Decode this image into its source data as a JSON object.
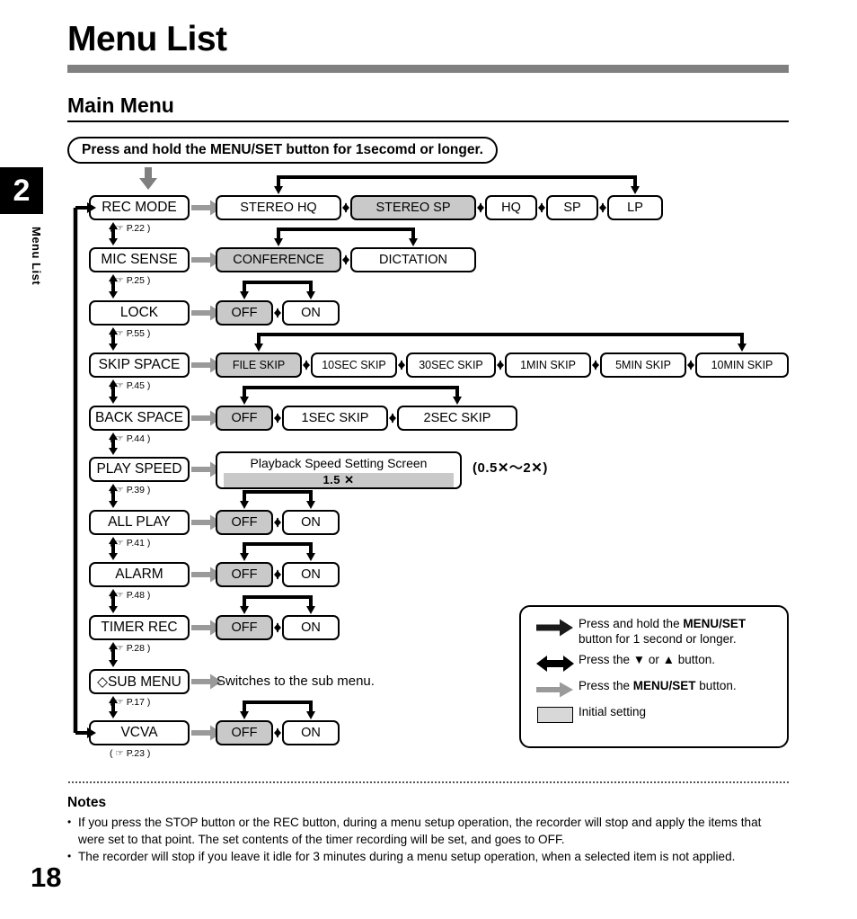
{
  "page": {
    "title": "Menu List",
    "section": "Main Menu",
    "number": "18",
    "tab_number": "2",
    "tab_label": "Menu List"
  },
  "entry_banner": {
    "text": "Press and hold the MENU/SET button for 1secomd or longer."
  },
  "menu_rows": [
    {
      "name": "REC MODE",
      "page_ref": "( ☞ P.22 )",
      "options": [
        "STEREO HQ",
        "STEREO SP",
        "HQ",
        "SP",
        "LP"
      ],
      "initial": "STEREO SP"
    },
    {
      "name": "MIC SENSE",
      "page_ref": "( ☞ P.25 )",
      "options": [
        "CONFERENCE",
        "DICTATION"
      ],
      "initial": "CONFERENCE"
    },
    {
      "name": "LOCK",
      "page_ref": "( ☞ P.55 )",
      "options": [
        "OFF",
        "ON"
      ],
      "initial": "OFF"
    },
    {
      "name": "SKIP SPACE",
      "page_ref": "( ☞ P.45 )",
      "options": [
        "FILE SKIP",
        "10SEC SKIP",
        "30SEC SKIP",
        "1MIN SKIP",
        "5MIN SKIP",
        "10MIN SKIP"
      ],
      "initial": "FILE SKIP"
    },
    {
      "name": "BACK SPACE",
      "page_ref": "( ☞ P.44 )",
      "options": [
        "OFF",
        "1SEC SKIP",
        "2SEC SKIP"
      ],
      "initial": "OFF"
    },
    {
      "name": "PLAY SPEED",
      "page_ref": "( ☞ P.39 )",
      "options": [],
      "initial": ""
    },
    {
      "name": "ALL PLAY",
      "page_ref": "( ☞ P.41 )",
      "options": [
        "OFF",
        "ON"
      ],
      "initial": "OFF"
    },
    {
      "name": "ALARM",
      "page_ref": "( ☞ P.48 )",
      "options": [
        "OFF",
        "ON"
      ],
      "initial": "OFF"
    },
    {
      "name": "TIMER REC",
      "page_ref": "( ☞ P.28 )",
      "options": [
        "OFF",
        "ON"
      ],
      "initial": "OFF"
    },
    {
      "name": "◇SUB MENU",
      "page_ref": "( ☞ P.17 )",
      "options": [],
      "initial": ""
    },
    {
      "name": "VCVA",
      "page_ref": "( ☞ P.23 )",
      "options": [
        "OFF",
        "ON"
      ],
      "initial": "OFF"
    }
  ],
  "play_speed": {
    "screen_title": "Playback Speed Setting Screen",
    "screen_value": "1.5 ✕",
    "range": "(0.5✕～2✕)"
  },
  "sub_menu": {
    "note": "Switches to the sub menu."
  },
  "legend": {
    "items": [
      {
        "icon": "black-thick-right-arrow-icon",
        "text_parts": [
          "Press and hold the ",
          "MENU/SET",
          ""
        ],
        "line2": "button for 1 second or longer."
      },
      {
        "icon": "black-double-head-arrow-icon",
        "text_parts": [
          "Press the ▼ or ▲ button."
        ],
        "line2": ""
      },
      {
        "icon": "gray-right-arrow-icon",
        "text_parts": [
          "Press the ",
          "MENU/SET",
          " button."
        ],
        "line2": ""
      },
      {
        "icon": "gray-swatch-icon",
        "text_parts": [
          "Initial setting"
        ],
        "line2": ""
      }
    ],
    "l1_a": "Press and hold the ",
    "l1_b": "MENU/SET",
    "l1_c": "button for 1 second or longer.",
    "l2": "Press the ▼ or ▲ button.",
    "l3_a": "Press the ",
    "l3_b": "MENU/SET",
    "l3_c": " button.",
    "l4": "Initial setting"
  },
  "notes": {
    "heading": "Notes",
    "items": [
      "If you press the STOP button or the REC button, during a menu setup operation, the recorder will stop and apply the items that were set to that point. The set contents of the timer recording will be set, and goes to OFF.",
      "The recorder will stop if you leave it idle for 3 minutes during a menu setup operation, when a selected item is not applied."
    ]
  },
  "colors": {
    "initial_fill": "#c9c9c9",
    "rule_gray": "#808080",
    "gray_arrow": "#9a9a9a"
  }
}
